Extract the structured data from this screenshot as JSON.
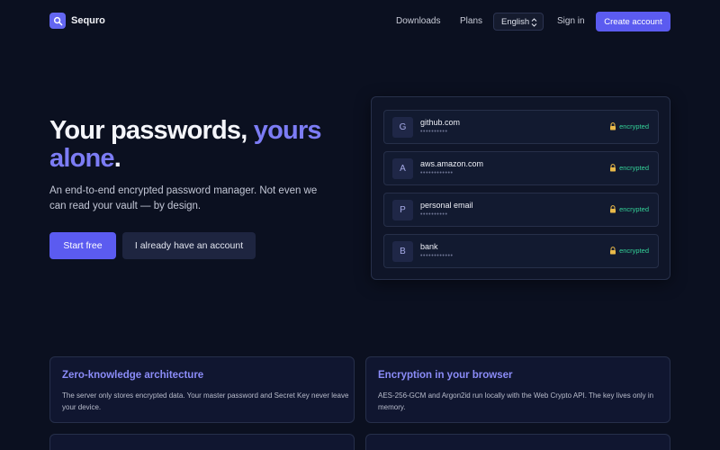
{
  "nav": {
    "brand": "Sequro",
    "links": [
      "Downloads",
      "Plans"
    ],
    "language": "English",
    "sign_in": "Sign in",
    "create_account": "Create account"
  },
  "hero": {
    "headline_part1": "Your passwords, ",
    "headline_accent": "yours alone",
    "headline_end": ".",
    "subtitle": "An end-to-end encrypted password manager. Not even we can read your vault — by design.",
    "primary_cta": "Start free",
    "secondary_cta": "I already have an account"
  },
  "vault": {
    "entries": [
      {
        "initial": "G",
        "site": "github.com",
        "masked": "••••••••••",
        "status": "encrypted"
      },
      {
        "initial": "A",
        "site": "aws.amazon.com",
        "masked": "••••••••••••",
        "status": "encrypted"
      },
      {
        "initial": "P",
        "site": "personal email",
        "masked": "••••••••••",
        "status": "encrypted"
      },
      {
        "initial": "B",
        "site": "bank",
        "masked": "••••••••••••",
        "status": "encrypted"
      }
    ]
  },
  "features": [
    {
      "title": "Zero-knowledge architecture",
      "body": "The server only stores encrypted data. Your master password and Secret Key never leave your device."
    },
    {
      "title": "Encryption in your browser",
      "body": "AES-256-GCM and Argon2id run locally with the Web Crypto API. The key lives only in memory."
    }
  ],
  "colors": {
    "background": "#0b1020",
    "accent": "#6366f1",
    "encrypted_status": "#34d399"
  }
}
